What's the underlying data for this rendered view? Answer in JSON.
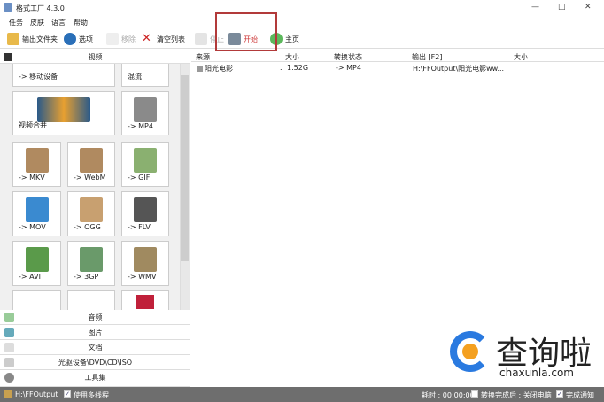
{
  "title": "格式工厂 4.3.0",
  "menu": [
    "任务",
    "皮肤",
    "语言",
    "帮助"
  ],
  "toolbar": {
    "output_folder": "输出文件夹",
    "options": "选项",
    "remove": "移除",
    "clear_list": "清空列表",
    "stop": "停止",
    "start": "开始",
    "home": "主页"
  },
  "left": {
    "header": "视频",
    "tiles": [
      {
        "label": "-> 移动设备"
      },
      {
        "label": "混流"
      },
      {
        "label": "视频合并"
      },
      {
        "label": "-> MP4"
      },
      {
        "label": "-> MKV"
      },
      {
        "label": "-> WebM"
      },
      {
        "label": "-> GIF"
      },
      {
        "label": "-> MOV"
      },
      {
        "label": "-> OGG"
      },
      {
        "label": "-> FLV"
      },
      {
        "label": "-> AVI"
      },
      {
        "label": "-> 3GP"
      },
      {
        "label": "-> WMV"
      }
    ],
    "categories": [
      "音频",
      "图片",
      "文档",
      "光驱设备\\DVD\\CD\\ISO",
      "工具集"
    ]
  },
  "table": {
    "columns": [
      "来源",
      "大小",
      "转换状态",
      "输出 [F2]",
      "大小"
    ],
    "rows": [
      {
        "source": "阳光电影",
        "dot": ".",
        "size": "1.52G",
        "status": "-> MP4",
        "output": "H:\\FFOutput\\阳光电影ww..."
      }
    ]
  },
  "status": {
    "path": "H:\\FFOutput",
    "multithread": "使用多线程",
    "elapsed": "耗时 : 00:00:00",
    "after": "转换完成后 : 关闭电脑",
    "notify": "完成通知"
  },
  "watermark": {
    "text": "查询啦",
    "url": "chaxunla.com"
  },
  "colors": {
    "highlight": "#b23a3a",
    "status_bg": "#6e6e6e"
  }
}
